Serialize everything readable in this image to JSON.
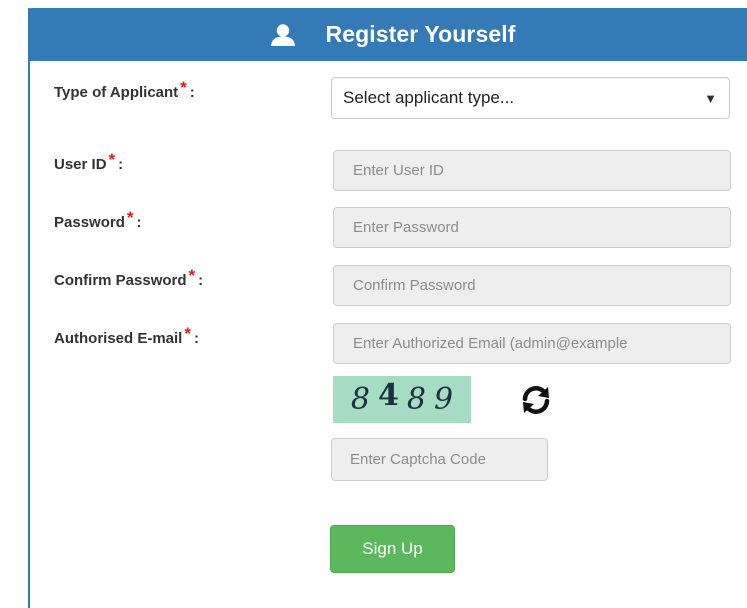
{
  "panel": {
    "title": "Register Yourself",
    "icon": "user-icon",
    "header_color": "#337ab7"
  },
  "form": {
    "applicant_type": {
      "label": "Type of Applicant",
      "required_mark": "*",
      "colon": ":",
      "selected_value": "Select applicant type..."
    },
    "user_id": {
      "label": "User ID",
      "required_mark": "*",
      "colon": ":",
      "placeholder": "Enter User ID"
    },
    "password": {
      "label": "Password",
      "required_mark": "*",
      "colon": ":",
      "placeholder": "Enter Password"
    },
    "confirm_password": {
      "label": "Confirm Password",
      "required_mark": "*",
      "colon": ":",
      "placeholder": "Confirm Password"
    },
    "email": {
      "label": "Authorised E-mail",
      "required_mark": "*",
      "colon": ":",
      "placeholder": "Enter Authorized Email (admin@example"
    },
    "captcha": {
      "chars": [
        "8",
        "4",
        "8",
        "9"
      ],
      "background_color": "#a7dcc4",
      "refresh_icon": "refresh-icon",
      "placeholder": "Enter Captcha Code"
    },
    "submit": {
      "label": "Sign Up",
      "color": "#5cb85c"
    }
  },
  "colors": {
    "required": "#e0191b",
    "input_background": "#eeeeee"
  }
}
